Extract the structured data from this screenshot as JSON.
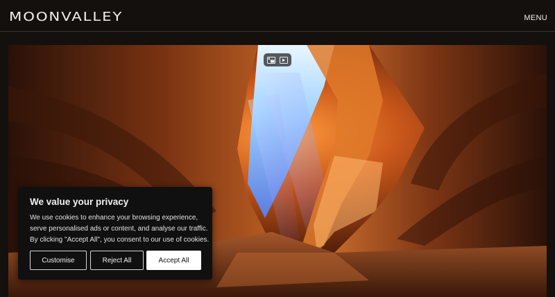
{
  "header": {
    "logo": "MOONVALLEY",
    "menu_label": "MENU"
  },
  "hero": {
    "controls": {
      "icons": [
        "picture-in-picture-icon",
        "play-settings-icon"
      ]
    }
  },
  "cookie_banner": {
    "title": "We value your privacy",
    "body_lines": [
      "We use cookies to enhance your browsing experience,",
      "serve personalised ads or content, and analyse our traffic.",
      "By clicking \"Accept All\", you consent to our use of cookies."
    ],
    "buttons": {
      "customise": "Customise",
      "reject": "Reject All",
      "accept": "Accept All"
    }
  },
  "colors": {
    "background": "#13100d",
    "text": "#f3efe9",
    "accept_button_bg": "#ffffff",
    "panel_bg": "#101010"
  }
}
